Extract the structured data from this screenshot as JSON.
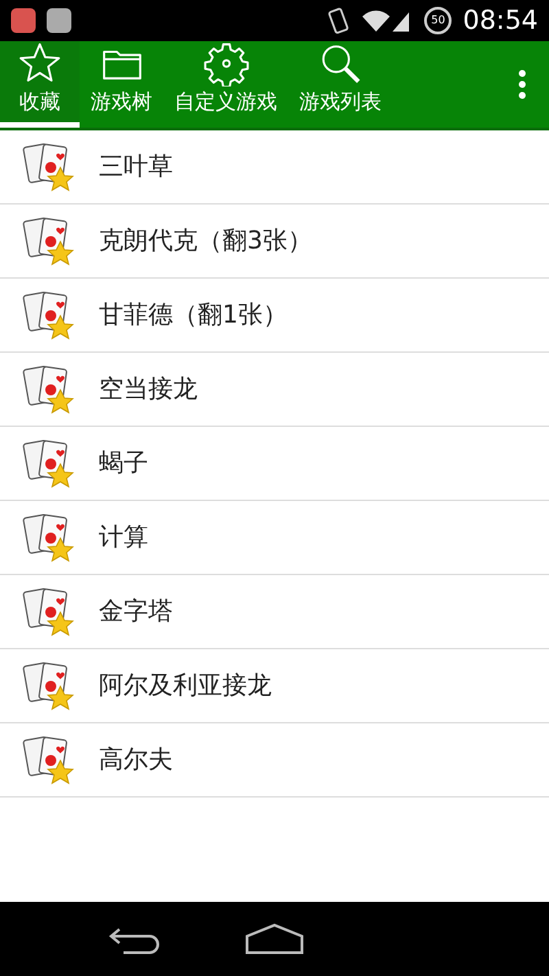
{
  "status_bar": {
    "battery": "50",
    "time": "08:54"
  },
  "tabs": [
    {
      "label": "收藏",
      "kind": "star",
      "selected": true
    },
    {
      "label": "游戏树",
      "kind": "folder",
      "selected": false
    },
    {
      "label": "自定义游戏",
      "kind": "gear",
      "selected": false
    },
    {
      "label": "游戏列表",
      "kind": "search",
      "selected": false
    }
  ],
  "games": [
    {
      "name": "三叶草"
    },
    {
      "name": "克朗代克（翻3张）"
    },
    {
      "name": "甘菲德（翻1张）"
    },
    {
      "name": "空当接龙"
    },
    {
      "name": "蝎子"
    },
    {
      "name": "计算"
    },
    {
      "name": "金字塔"
    },
    {
      "name": "阿尔及利亚接龙"
    },
    {
      "name": "高尔夫"
    }
  ]
}
